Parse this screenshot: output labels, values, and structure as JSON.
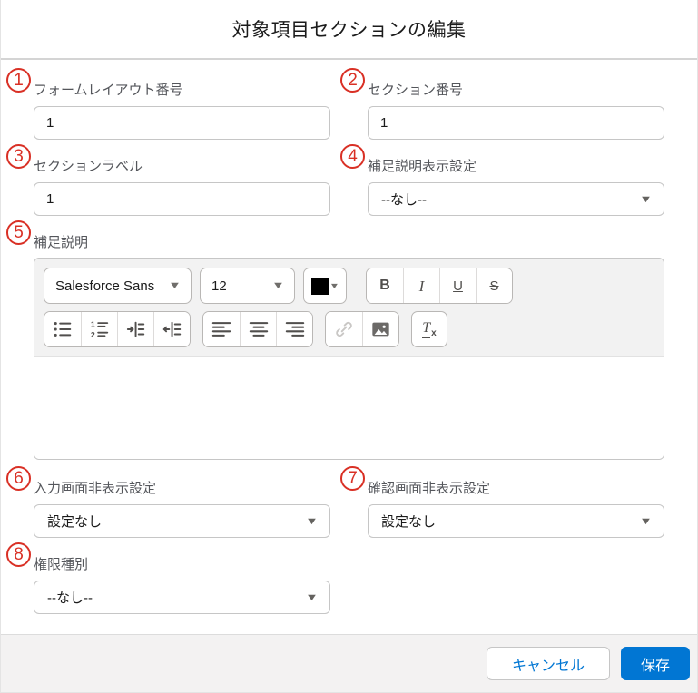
{
  "dialog": {
    "title": "対象項目セクションの編集"
  },
  "fields": {
    "form_layout_number": {
      "badge": "1",
      "label": "フォームレイアウト番号",
      "value": "1"
    },
    "section_number": {
      "badge": "2",
      "label": "セクション番号",
      "value": "1"
    },
    "section_label": {
      "badge": "3",
      "label": "セクションラベル",
      "value": "1"
    },
    "supplement_display_setting": {
      "badge": "4",
      "label": "補足説明表示設定",
      "value": "--なし--"
    },
    "supplement_description": {
      "badge": "5",
      "label": "補足説明",
      "value": ""
    },
    "input_screen_hide_setting": {
      "badge": "6",
      "label": "入力画面非表示設定",
      "value": "設定なし"
    },
    "confirm_screen_hide_setting": {
      "badge": "7",
      "label": "確認画面非表示設定",
      "value": "設定なし"
    },
    "permission_type": {
      "badge": "8",
      "label": "権限種別",
      "value": "--なし--"
    }
  },
  "editor": {
    "font_family_value": "Salesforce Sans",
    "font_size_value": "12",
    "buttons": {
      "bold": "B",
      "italic": "I",
      "underline": "U",
      "strikethrough": "S",
      "clear_format_t": "T",
      "clear_format_x": "x"
    },
    "list_numbers": {
      "one": "1",
      "two": "2"
    },
    "icon_names": [
      "bullet-list",
      "numbered-list",
      "indent",
      "outdent",
      "align-left",
      "align-center",
      "align-right",
      "insert-link",
      "insert-image",
      "clear-format"
    ]
  },
  "icons": {
    "caret_down": "▼"
  },
  "footer": {
    "cancel_label": "キャンセル",
    "save_label": "保存"
  },
  "colors": {
    "accent_blue": "#0176d3",
    "annotation_red": "#d93025",
    "text_color_swatch": "#000000",
    "toolbar_bg": "#f2f2f2",
    "footer_bg": "#f3f2f2"
  }
}
